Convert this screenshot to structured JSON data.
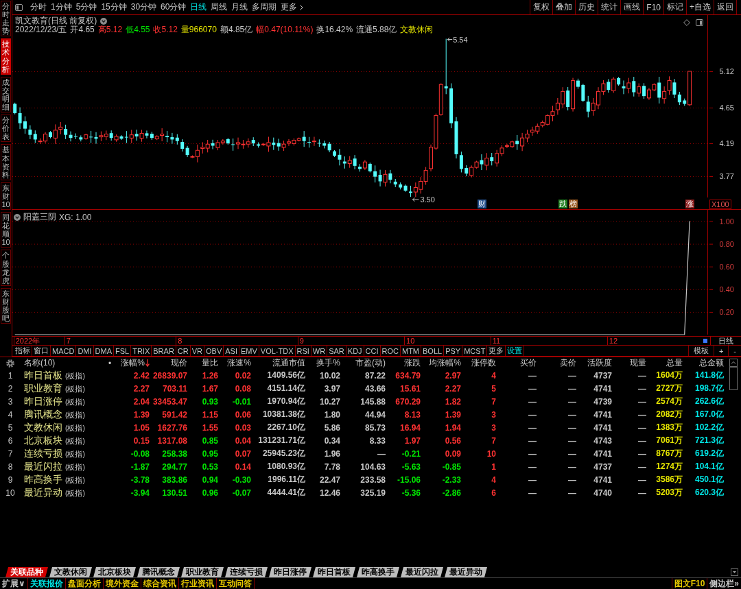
{
  "sidebar": {
    "tabs": [
      {
        "label": "分时走势",
        "selected": false
      },
      {
        "label": "技术分析",
        "selected": true
      },
      {
        "label": "成交明细",
        "selected": false
      },
      {
        "label": "分价表",
        "selected": false
      },
      {
        "label": "基本资料",
        "selected": false
      },
      {
        "label": "东财10",
        "selected": false
      },
      {
        "label": "同花顺10",
        "selected": false
      },
      {
        "label": "个股龙虎",
        "selected": false
      },
      {
        "label": "东财股吧",
        "selected": false
      }
    ]
  },
  "toolbar": {
    "periods": [
      {
        "label": "分时",
        "selected": false
      },
      {
        "label": "1分钟",
        "selected": false
      },
      {
        "label": "5分钟",
        "selected": false
      },
      {
        "label": "15分钟",
        "selected": false
      },
      {
        "label": "30分钟",
        "selected": false
      },
      {
        "label": "60分钟",
        "selected": false
      },
      {
        "label": "日线",
        "selected": true
      },
      {
        "label": "周线",
        "selected": false
      },
      {
        "label": "月线",
        "selected": false
      },
      {
        "label": "多周期",
        "selected": false
      }
    ],
    "more": "更多",
    "buttons": [
      "复权",
      "叠加",
      "历史",
      "统计",
      "画线",
      "F10",
      "标记",
      "+自选",
      "返回"
    ]
  },
  "price_chart": {
    "title": "凯文教育(日线 前复权)",
    "quote": [
      {
        "text": "2022/12/23/五",
        "color": "#c8c8c8"
      },
      {
        "text": "开4.65",
        "color": "#c8c8c8"
      },
      {
        "text": "高5.12",
        "color": "#ff3232"
      },
      {
        "text": "低4.55",
        "color": "#00e600"
      },
      {
        "text": "收5.12",
        "color": "#ff3232"
      },
      {
        "text": "量966070",
        "color": "#e6e600"
      },
      {
        "text": "额4.85亿",
        "color": "#c8c8c8"
      },
      {
        "text": "幅0.47(10.11%)",
        "color": "#ff3232"
      },
      {
        "text": "换16.42%",
        "color": "#c8c8c8"
      },
      {
        "text": "流通5.88亿",
        "color": "#c8c8c8"
      },
      {
        "text": "文教休闲",
        "color": "#e6e600"
      }
    ],
    "price_ticks": [
      "5.12",
      "4.65",
      "4.19",
      "3.77"
    ],
    "scale": "X100",
    "high_label": "5.54",
    "low_label": "3.50",
    "events": [
      {
        "text": "财",
        "color": "#24508c"
      },
      {
        "text": "跌",
        "color": "#1e7d1e"
      },
      {
        "text": "榜",
        "color": "#96561e"
      },
      {
        "text": "涨",
        "color": "#8c1e1e"
      }
    ]
  },
  "indicator": {
    "title": "阳盖三阴",
    "reading": ": 1.00",
    "chart_data": {
      "type": "line",
      "grid": true,
      "ylim": [
        0,
        1.1
      ],
      "yticks": [
        {
          "value": 1,
          "label": "1.00"
        },
        {
          "value": 0.8,
          "label": "0.80"
        },
        {
          "value": 0.6,
          "label": "0.60"
        },
        {
          "value": 0.4,
          "label": "0.40"
        },
        {
          "value": 0.2,
          "label": "0.20"
        }
      ],
      "series": [
        {
          "name": "XG",
          "color": "#c8c8c8",
          "values": [
            0,
            0,
            0,
            0,
            0,
            0,
            0,
            0,
            0,
            0,
            0,
            0,
            0,
            0,
            0,
            0,
            0,
            0,
            0,
            0,
            0,
            0,
            0,
            0,
            0,
            0,
            0,
            0,
            0,
            0,
            0,
            0,
            0,
            0,
            0,
            0,
            0,
            0,
            0,
            0,
            0,
            0,
            0,
            0,
            0,
            0,
            0,
            0,
            0,
            0,
            0,
            0,
            0,
            0,
            0,
            0,
            0,
            0,
            0,
            0,
            0,
            0,
            0,
            0,
            0,
            0,
            0,
            0,
            0,
            0,
            0,
            0,
            0,
            0,
            0,
            0,
            0,
            0,
            0,
            0,
            0,
            0,
            0,
            0,
            0,
            0,
            0,
            0,
            0,
            0,
            0,
            0,
            0,
            0,
            0,
            0,
            0,
            0,
            0,
            0,
            0,
            0,
            0,
            0,
            0,
            0,
            0,
            0,
            0,
            0,
            0,
            0,
            0,
            0,
            0,
            0,
            0,
            0,
            0,
            0,
            0,
            0,
            0,
            0,
            0,
            0,
            0,
            0,
            0,
            0,
            0,
            0,
            0,
            1,
            null,
            null,
            null
          ]
        }
      ]
    }
  },
  "date_axis": {
    "labels": [
      "2022年",
      "7",
      "8",
      "9",
      "10",
      "11",
      "12"
    ],
    "period": "日线"
  },
  "indicator_tabs": {
    "tabs": [
      "指标",
      "窗口",
      "MACD",
      "DMI",
      "DMA",
      "FSL",
      "TRIX",
      "BRAR",
      "CR",
      "VR",
      "OBV",
      "ASI",
      "EMV",
      "VOL-TDX",
      "RSI",
      "WR",
      "SAR",
      "KDJ",
      "CCI",
      "ROC",
      "MTM",
      "BOLL",
      "PSY",
      "MCST",
      "更多"
    ],
    "settings": "设置",
    "tools": [
      "模板",
      "+",
      "-"
    ]
  },
  "table": {
    "columns": [
      {
        "label": "名称(10)",
        "sorted": false
      },
      {
        "label": "•",
        "sorted": false
      },
      {
        "label": "涨幅%",
        "sorted": true
      },
      {
        "label": "现价",
        "sorted": false
      },
      {
        "label": "量比",
        "sorted": false
      },
      {
        "label": "涨速%",
        "sorted": false
      },
      {
        "label": "流通市值",
        "sorted": false
      },
      {
        "label": "换手%",
        "sorted": false
      },
      {
        "label": "市盈(动)",
        "sorted": false
      },
      {
        "label": "涨跌",
        "sorted": false
      },
      {
        "label": "均涨幅%",
        "sorted": false
      },
      {
        "label": "涨停数",
        "sorted": false
      },
      {
        "label": "买价",
        "sorted": false
      },
      {
        "label": "卖价",
        "sorted": false
      },
      {
        "label": "活跃度",
        "sorted": false
      },
      {
        "label": "现量",
        "sorted": false
      },
      {
        "label": "总量",
        "sorted": false
      },
      {
        "label": "总金额",
        "sorted": false
      }
    ],
    "rows": [
      {
        "no": "1",
        "cells": [
          {
            "text": "昨日首板",
            "tag": "(板指)"
          },
          {
            "text": ""
          },
          {
            "text": "2.42",
            "color": "#ff3232"
          },
          {
            "text": "26839.07",
            "color": "#ff3232"
          },
          {
            "text": "1.26",
            "color": "#ff3232"
          },
          {
            "text": "0.02",
            "color": "#ff3232"
          },
          {
            "text": "1409.56亿",
            "color": "#c8c8c8"
          },
          {
            "text": "10.02",
            "color": "#c8c8c8"
          },
          {
            "text": "87.22",
            "color": "#c8c8c8"
          },
          {
            "text": "634.79",
            "color": "#ff3232"
          },
          {
            "text": "2.97",
            "color": "#ff3232"
          },
          {
            "text": "4",
            "color": "#ff3232"
          },
          {
            "text": "—",
            "color": "#c8c8c8"
          },
          {
            "text": "—",
            "color": "#c8c8c8"
          },
          {
            "text": "4737",
            "color": "#c8c8c8"
          },
          {
            "text": "—",
            "color": "#c8c8c8"
          },
          {
            "text": "1604万",
            "color": "#e6e600"
          },
          {
            "text": "141.8亿",
            "color": "#00e6e6"
          }
        ]
      },
      {
        "no": "2",
        "cells": [
          {
            "text": "职业教育",
            "tag": "(板指)"
          },
          {
            "text": ""
          },
          {
            "text": "2.27",
            "color": "#ff3232"
          },
          {
            "text": "703.11",
            "color": "#ff3232"
          },
          {
            "text": "1.67",
            "color": "#ff3232"
          },
          {
            "text": "0.08",
            "color": "#ff3232"
          },
          {
            "text": "4151.14亿",
            "color": "#c8c8c8"
          },
          {
            "text": "3.97",
            "color": "#c8c8c8"
          },
          {
            "text": "43.66",
            "color": "#c8c8c8"
          },
          {
            "text": "15.61",
            "color": "#ff3232"
          },
          {
            "text": "2.27",
            "color": "#ff3232"
          },
          {
            "text": "5",
            "color": "#ff3232"
          },
          {
            "text": "—",
            "color": "#c8c8c8"
          },
          {
            "text": "—",
            "color": "#c8c8c8"
          },
          {
            "text": "4741",
            "color": "#c8c8c8"
          },
          {
            "text": "—",
            "color": "#c8c8c8"
          },
          {
            "text": "2727万",
            "color": "#e6e600"
          },
          {
            "text": "198.7亿",
            "color": "#00e6e6"
          }
        ]
      },
      {
        "no": "3",
        "cells": [
          {
            "text": "昨日涨停",
            "tag": "(板指)"
          },
          {
            "text": ""
          },
          {
            "text": "2.04",
            "color": "#ff3232"
          },
          {
            "text": "33453.47",
            "color": "#ff3232"
          },
          {
            "text": "0.93",
            "color": "#00e600"
          },
          {
            "text": "-0.01",
            "color": "#00e600"
          },
          {
            "text": "1970.94亿",
            "color": "#c8c8c8"
          },
          {
            "text": "10.27",
            "color": "#c8c8c8"
          },
          {
            "text": "145.88",
            "color": "#c8c8c8"
          },
          {
            "text": "670.29",
            "color": "#ff3232"
          },
          {
            "text": "1.82",
            "color": "#ff3232"
          },
          {
            "text": "7",
            "color": "#ff3232"
          },
          {
            "text": "—",
            "color": "#c8c8c8"
          },
          {
            "text": "—",
            "color": "#c8c8c8"
          },
          {
            "text": "4739",
            "color": "#c8c8c8"
          },
          {
            "text": "—",
            "color": "#c8c8c8"
          },
          {
            "text": "2574万",
            "color": "#e6e600"
          },
          {
            "text": "262.6亿",
            "color": "#00e6e6"
          }
        ]
      },
      {
        "no": "4",
        "cells": [
          {
            "text": "腾讯概念",
            "tag": "(板指)"
          },
          {
            "text": ""
          },
          {
            "text": "1.39",
            "color": "#ff3232"
          },
          {
            "text": "591.42",
            "color": "#ff3232"
          },
          {
            "text": "1.15",
            "color": "#ff3232"
          },
          {
            "text": "0.06",
            "color": "#ff3232"
          },
          {
            "text": "10381.38亿",
            "color": "#c8c8c8"
          },
          {
            "text": "1.80",
            "color": "#c8c8c8"
          },
          {
            "text": "44.94",
            "color": "#c8c8c8"
          },
          {
            "text": "8.13",
            "color": "#ff3232"
          },
          {
            "text": "1.39",
            "color": "#ff3232"
          },
          {
            "text": "3",
            "color": "#ff3232"
          },
          {
            "text": "—",
            "color": "#c8c8c8"
          },
          {
            "text": "—",
            "color": "#c8c8c8"
          },
          {
            "text": "4741",
            "color": "#c8c8c8"
          },
          {
            "text": "—",
            "color": "#c8c8c8"
          },
          {
            "text": "2082万",
            "color": "#e6e600"
          },
          {
            "text": "167.0亿",
            "color": "#00e6e6"
          }
        ]
      },
      {
        "no": "5",
        "cells": [
          {
            "text": "文教休闲",
            "tag": "(板指)"
          },
          {
            "text": ""
          },
          {
            "text": "1.05",
            "color": "#ff3232"
          },
          {
            "text": "1627.76",
            "color": "#ff3232"
          },
          {
            "text": "1.55",
            "color": "#ff3232"
          },
          {
            "text": "0.03",
            "color": "#ff3232"
          },
          {
            "text": "2267.10亿",
            "color": "#c8c8c8"
          },
          {
            "text": "5.86",
            "color": "#c8c8c8"
          },
          {
            "text": "85.73",
            "color": "#c8c8c8"
          },
          {
            "text": "16.94",
            "color": "#ff3232"
          },
          {
            "text": "1.94",
            "color": "#ff3232"
          },
          {
            "text": "3",
            "color": "#ff3232"
          },
          {
            "text": "—",
            "color": "#c8c8c8"
          },
          {
            "text": "—",
            "color": "#c8c8c8"
          },
          {
            "text": "4741",
            "color": "#c8c8c8"
          },
          {
            "text": "—",
            "color": "#c8c8c8"
          },
          {
            "text": "1383万",
            "color": "#e6e600"
          },
          {
            "text": "102.2亿",
            "color": "#00e6e6"
          }
        ]
      },
      {
        "no": "6",
        "cells": [
          {
            "text": "北京板块",
            "tag": "(板指)"
          },
          {
            "text": ""
          },
          {
            "text": "0.15",
            "color": "#ff3232"
          },
          {
            "text": "1317.08",
            "color": "#ff3232"
          },
          {
            "text": "0.85",
            "color": "#00e600"
          },
          {
            "text": "0.04",
            "color": "#ff3232"
          },
          {
            "text": "131231.71亿",
            "color": "#c8c8c8"
          },
          {
            "text": "0.34",
            "color": "#c8c8c8"
          },
          {
            "text": "8.33",
            "color": "#c8c8c8"
          },
          {
            "text": "1.97",
            "color": "#ff3232"
          },
          {
            "text": "0.56",
            "color": "#ff3232"
          },
          {
            "text": "7",
            "color": "#ff3232"
          },
          {
            "text": "—",
            "color": "#c8c8c8"
          },
          {
            "text": "—",
            "color": "#c8c8c8"
          },
          {
            "text": "4743",
            "color": "#c8c8c8"
          },
          {
            "text": "—",
            "color": "#c8c8c8"
          },
          {
            "text": "7061万",
            "color": "#e6e600"
          },
          {
            "text": "721.3亿",
            "color": "#00e6e6"
          }
        ]
      },
      {
        "no": "7",
        "cells": [
          {
            "text": "连续亏损",
            "tag": "(板指)"
          },
          {
            "text": ""
          },
          {
            "text": "-0.08",
            "color": "#00e600"
          },
          {
            "text": "258.38",
            "color": "#00e600"
          },
          {
            "text": "0.95",
            "color": "#00e600"
          },
          {
            "text": "0.07",
            "color": "#ff3232"
          },
          {
            "text": "25945.23亿",
            "color": "#c8c8c8"
          },
          {
            "text": "1.96",
            "color": "#c8c8c8"
          },
          {
            "text": "—",
            "color": "#c8c8c8"
          },
          {
            "text": "-0.21",
            "color": "#00e600"
          },
          {
            "text": "0.09",
            "color": "#ff3232"
          },
          {
            "text": "10",
            "color": "#ff3232"
          },
          {
            "text": "—",
            "color": "#c8c8c8"
          },
          {
            "text": "—",
            "color": "#c8c8c8"
          },
          {
            "text": "4741",
            "color": "#c8c8c8"
          },
          {
            "text": "—",
            "color": "#c8c8c8"
          },
          {
            "text": "8767万",
            "color": "#e6e600"
          },
          {
            "text": "619.2亿",
            "color": "#00e6e6"
          }
        ]
      },
      {
        "no": "8",
        "cells": [
          {
            "text": "最近闪拉",
            "tag": "(板指)"
          },
          {
            "text": ""
          },
          {
            "text": "-1.87",
            "color": "#00e600"
          },
          {
            "text": "294.77",
            "color": "#00e600"
          },
          {
            "text": "0.53",
            "color": "#00e600"
          },
          {
            "text": "0.14",
            "color": "#ff3232"
          },
          {
            "text": "1080.93亿",
            "color": "#c8c8c8"
          },
          {
            "text": "7.78",
            "color": "#c8c8c8"
          },
          {
            "text": "104.63",
            "color": "#c8c8c8"
          },
          {
            "text": "-5.63",
            "color": "#00e600"
          },
          {
            "text": "-0.85",
            "color": "#00e600"
          },
          {
            "text": "1",
            "color": "#ff3232"
          },
          {
            "text": "—",
            "color": "#c8c8c8"
          },
          {
            "text": "—",
            "color": "#c8c8c8"
          },
          {
            "text": "4737",
            "color": "#c8c8c8"
          },
          {
            "text": "—",
            "color": "#c8c8c8"
          },
          {
            "text": "1274万",
            "color": "#e6e600"
          },
          {
            "text": "104.1亿",
            "color": "#00e6e6"
          }
        ]
      },
      {
        "no": "9",
        "cells": [
          {
            "text": "昨高换手",
            "tag": "(板指)"
          },
          {
            "text": ""
          },
          {
            "text": "-3.78",
            "color": "#00e600"
          },
          {
            "text": "383.86",
            "color": "#00e600"
          },
          {
            "text": "0.94",
            "color": "#00e600"
          },
          {
            "text": "-0.30",
            "color": "#00e600"
          },
          {
            "text": "1996.11亿",
            "color": "#c8c8c8"
          },
          {
            "text": "22.47",
            "color": "#c8c8c8"
          },
          {
            "text": "233.58",
            "color": "#c8c8c8"
          },
          {
            "text": "-15.06",
            "color": "#00e600"
          },
          {
            "text": "-2.33",
            "color": "#00e600"
          },
          {
            "text": "4",
            "color": "#ff3232"
          },
          {
            "text": "—",
            "color": "#c8c8c8"
          },
          {
            "text": "—",
            "color": "#c8c8c8"
          },
          {
            "text": "4741",
            "color": "#c8c8c8"
          },
          {
            "text": "—",
            "color": "#c8c8c8"
          },
          {
            "text": "3586万",
            "color": "#e6e600"
          },
          {
            "text": "450.1亿",
            "color": "#00e6e6"
          }
        ]
      },
      {
        "no": "10",
        "cells": [
          {
            "text": "最近异动",
            "tag": "(板指)"
          },
          {
            "text": ""
          },
          {
            "text": "-3.94",
            "color": "#00e600"
          },
          {
            "text": "130.51",
            "color": "#00e600"
          },
          {
            "text": "0.96",
            "color": "#00e600"
          },
          {
            "text": "-0.07",
            "color": "#00e600"
          },
          {
            "text": "4444.41亿",
            "color": "#c8c8c8"
          },
          {
            "text": "12.46",
            "color": "#c8c8c8"
          },
          {
            "text": "325.19",
            "color": "#c8c8c8"
          },
          {
            "text": "-5.36",
            "color": "#00e600"
          },
          {
            "text": "-2.86",
            "color": "#00e600"
          },
          {
            "text": "6",
            "color": "#ff3232"
          },
          {
            "text": "—",
            "color": "#c8c8c8"
          },
          {
            "text": "—",
            "color": "#c8c8c8"
          },
          {
            "text": "4740",
            "color": "#c8c8c8"
          },
          {
            "text": "—",
            "color": "#c8c8c8"
          },
          {
            "text": "5203万",
            "color": "#e6e600"
          },
          {
            "text": "620.3亿",
            "color": "#00e6e6"
          }
        ]
      }
    ]
  },
  "sheet_tabs": [
    {
      "label": "关联品种",
      "selected": true
    },
    {
      "label": "文教休闲",
      "selected": false
    },
    {
      "label": "北京板块",
      "selected": false
    },
    {
      "label": "腾讯概念",
      "selected": false
    },
    {
      "label": "职业教育",
      "selected": false
    },
    {
      "label": "连续亏损",
      "selected": false
    },
    {
      "label": "昨日涨停",
      "selected": false
    },
    {
      "label": "昨日首板",
      "selected": false
    },
    {
      "label": "昨高换手",
      "selected": false
    },
    {
      "label": "最近闪拉",
      "selected": false
    },
    {
      "label": "最近异动",
      "selected": false
    }
  ],
  "status_bar": {
    "left": [
      {
        "text": "扩展∨",
        "color": "#c8c8c8"
      },
      {
        "text": "关联报价",
        "color": "#00e6e6"
      },
      {
        "text": "盘面分析",
        "color": "#e6c800"
      },
      {
        "text": "境外资金",
        "color": "#e6c800"
      },
      {
        "text": "综合资讯",
        "color": "#e6c800"
      },
      {
        "text": "行业资讯",
        "color": "#e6c800"
      },
      {
        "text": "互动问答",
        "color": "#e6c800"
      }
    ],
    "right": [
      {
        "text": "图文F10",
        "color": "#e6c800"
      },
      {
        "text": "侧边栏»",
        "color": "#c8c8c8"
      }
    ]
  }
}
